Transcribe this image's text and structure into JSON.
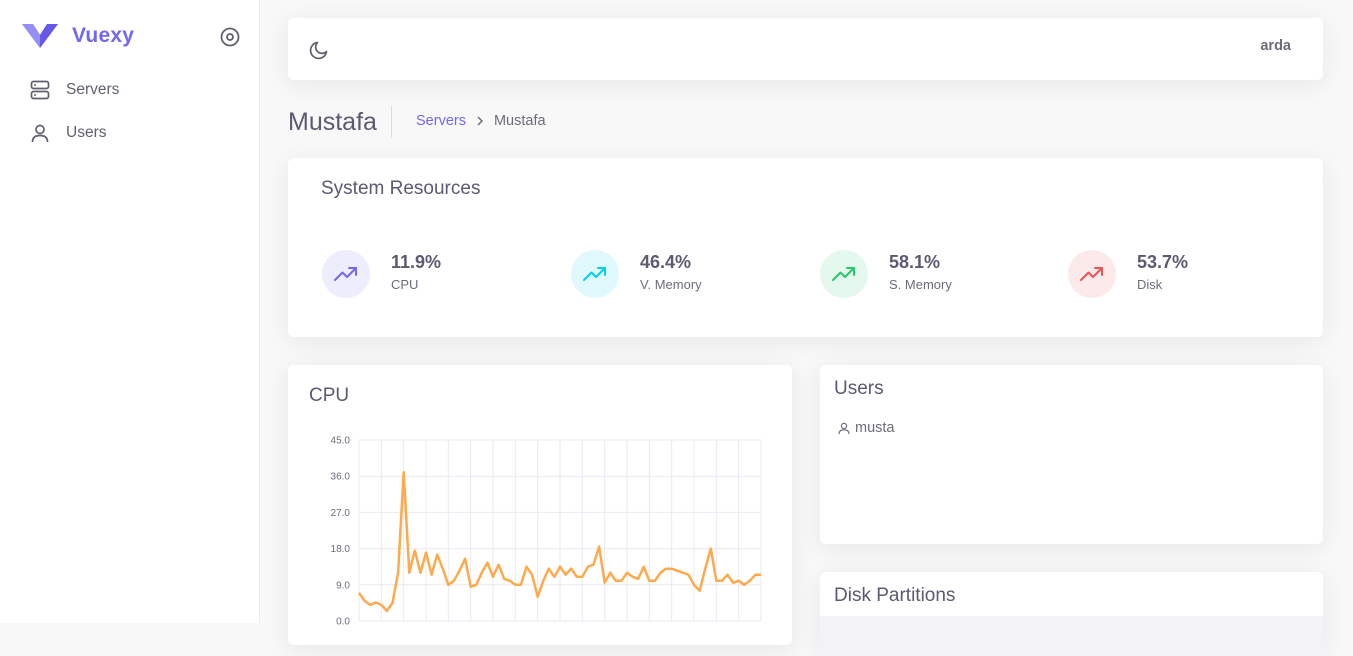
{
  "sidebar": {
    "brand": "Vuexy",
    "items": [
      {
        "label": "Servers",
        "icon": "server-icon"
      },
      {
        "label": "Users",
        "icon": "user-icon"
      }
    ]
  },
  "navbar": {
    "user_name": "arda"
  },
  "page": {
    "title": "Mustafa",
    "breadcrumb": {
      "link": "Servers",
      "current": "Mustafa"
    }
  },
  "resources": {
    "title": "System Resources",
    "stats": [
      {
        "value": "11.9%",
        "label": "CPU",
        "color": "#7367f0",
        "bg": "#eeedfd"
      },
      {
        "value": "46.4%",
        "label": "V. Memory",
        "color": "#00cfe8",
        "bg": "#e0f9fc"
      },
      {
        "value": "58.1%",
        "label": "S. Memory",
        "color": "#28c76f",
        "bg": "#e5f8ed"
      },
      {
        "value": "53.7%",
        "label": "Disk",
        "color": "#ea5455",
        "bg": "#fceaea"
      }
    ]
  },
  "cpu": {
    "title": "CPU"
  },
  "users_card": {
    "title": "Users",
    "users": [
      "musta"
    ]
  },
  "disk": {
    "title": "Disk Partitions"
  },
  "chart_data": {
    "type": "line",
    "title": "CPU",
    "ylim": [
      0,
      45
    ],
    "yticks": [
      "45.0",
      "36.0",
      "27.0",
      "18.0",
      "9.0",
      "0.0"
    ],
    "grid": true,
    "color": "#ffa94d",
    "series": [
      {
        "values": [
          7,
          5,
          4,
          4.6,
          4,
          2.5,
          4.5,
          12,
          37,
          12,
          17.5,
          12,
          17,
          11.5,
          16.5,
          13,
          9,
          10,
          12.5,
          15.5,
          8.5,
          9,
          12,
          14.5,
          11,
          14,
          10.5,
          10,
          9,
          9,
          13.5,
          11.5,
          6,
          10,
          13,
          11,
          13.5,
          11.5,
          13,
          11,
          11,
          13.5,
          14,
          18.5,
          9.5,
          12,
          10,
          10,
          12,
          11,
          10.5,
          13.5,
          10,
          10,
          12,
          13,
          13,
          12.5,
          12,
          11.5,
          9,
          7.5,
          13,
          18,
          10,
          10,
          11.5,
          9.5,
          10,
          9,
          10,
          11.5,
          11.5
        ]
      }
    ]
  }
}
